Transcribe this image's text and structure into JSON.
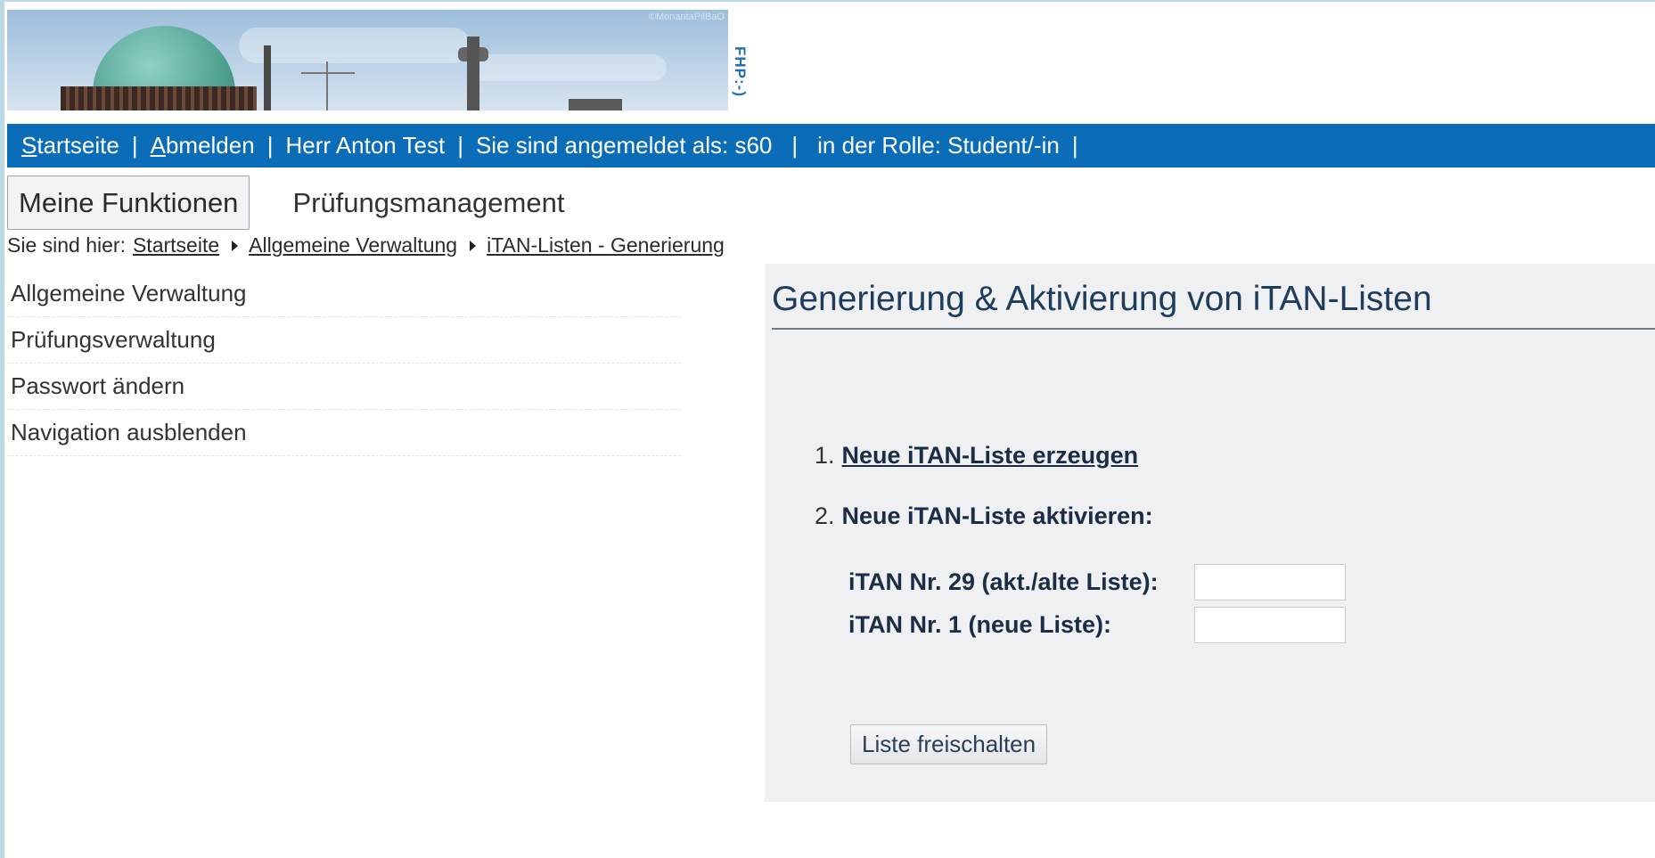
{
  "banner": {
    "watermark": "©MonantaPilBaO",
    "side_label": "FHP:-)"
  },
  "topbar": {
    "home_label": "Startseite",
    "home_accesskey": "S",
    "home_rest": "tartseite",
    "logout_accesskey": "A",
    "logout_rest": "bmelden",
    "user_name": "Herr Anton Test",
    "logged_in_as": "Sie sind angemeldet als: s60",
    "role": "in der Rolle: Student/-in",
    "separator": "|"
  },
  "tabs": {
    "active": "Meine Funktionen",
    "other": "Prüfungsmanagement"
  },
  "breadcrumb": {
    "prefix": "Sie sind hier:",
    "items": [
      "Startseite",
      "Allgemeine Verwaltung",
      "iTAN-Listen - Generierung"
    ]
  },
  "leftnav": {
    "items": [
      "Allgemeine Verwaltung",
      "Prüfungsverwaltung",
      "Passwort ändern",
      "Navigation ausblenden"
    ]
  },
  "main": {
    "title": "Generierung & Aktivierung von iTAN-Listen",
    "step1_num": "1.",
    "step1_label": "Neue iTAN-Liste erzeugen",
    "step2_num": "2.",
    "step2_label": "Neue iTAN-Liste aktivieren:",
    "field1_label": "iTAN Nr. 29 (akt./alte Liste):",
    "field1_value": "",
    "field2_label": "iTAN Nr. 1 (neue Liste):",
    "field2_value": "",
    "submit_label": "Liste freischalten"
  },
  "colors": {
    "topbar": "#0b6db7",
    "panel": "#eef0f2",
    "heading": "#1f3c5a"
  }
}
